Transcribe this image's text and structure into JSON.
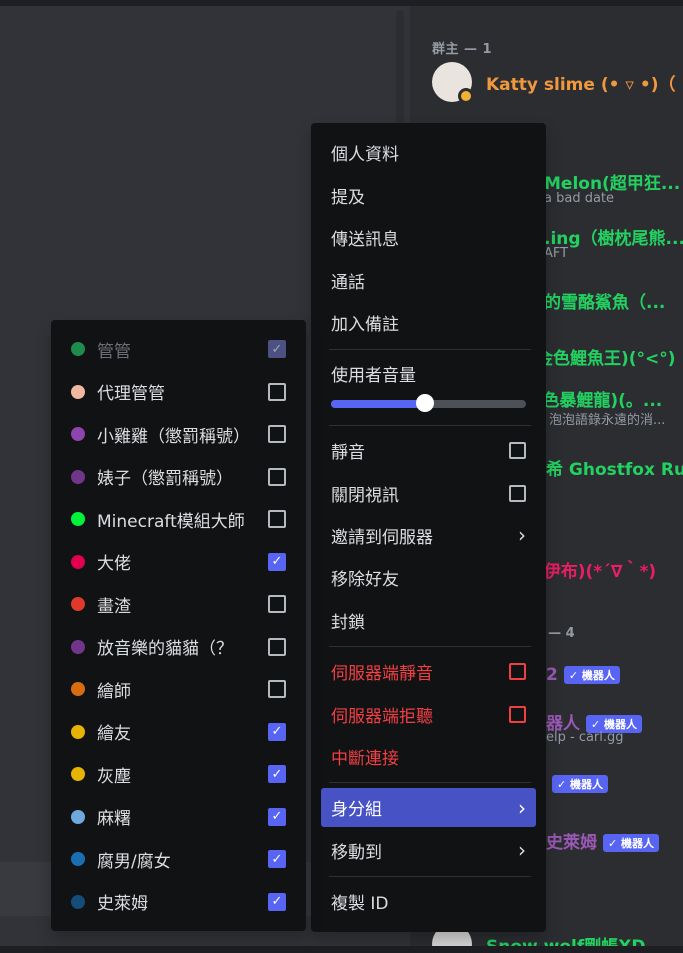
{
  "member_list": {
    "owner_header": "群主 — 1",
    "owner": {
      "name": "Katty slime (• ▿ •)（ ...",
      "color": "#f0983e"
    },
    "partials": [
      {
        "text": "Melon(超甲狂...",
        "color": "#23d160"
      },
      {
        "text": "a bad date",
        "color": "#949ba4"
      },
      {
        "text": ".ing（樹枕尾熊...",
        "color": "#23d160"
      },
      {
        "text": "AFT",
        "color": "#949ba4"
      },
      {
        "text": "的雪酪鯊魚（...",
        "color": "#23d160"
      },
      {
        "text": "金色鯉魚王)(°<°)",
        "color": "#23d160"
      },
      {
        "text": "I色暴鯉龍)(。...",
        "color": "#23d160"
      },
      {
        "text": "、泡泡語錄永遠的消...",
        "color": "#949ba4"
      },
      {
        "text": "希 Ghostfox Ru...",
        "color": "#23d160"
      },
      {
        "text": "(伊布)(*´∇｀*)",
        "color": "#e91e63"
      },
      {
        "text": "? — 4",
        "color": "#949ba4"
      },
      {
        "text": "2",
        "color": "#9b59b6"
      },
      {
        "text": "器人",
        "color": "#9b59b6"
      },
      {
        "text": "elp - carl.gg",
        "color": "#949ba4"
      },
      {
        "text": "史萊姆",
        "color": "#9b59b6"
      },
      {
        "text": "Snow wolf剛帳XD",
        "color": "#23d160"
      }
    ],
    "bot_tag": "✓ 機器人"
  },
  "context_menu": {
    "items": [
      {
        "label": "個人資料"
      },
      {
        "label": "提及"
      },
      {
        "label": "傳送訊息"
      },
      {
        "label": "通話"
      },
      {
        "label": "加入備註"
      }
    ],
    "volume_label": "使用者音量",
    "volume": 0.48,
    "toggles": [
      {
        "label": "靜音"
      },
      {
        "label": "關閉視訊"
      }
    ],
    "invite_label": "邀請到伺服器",
    "remove_friend_label": "移除好友",
    "block_label": "封鎖",
    "server_mute_label": "伺服器端靜音",
    "server_deafen_label": "伺服器端拒聽",
    "disconnect_label": "中斷連接",
    "roles_label": "身分組",
    "move_label": "移動到",
    "copy_id_label": "複製 ID"
  },
  "roles": [
    {
      "name": "管管",
      "color": "#1f8b4c",
      "checked": true,
      "disabled": true
    },
    {
      "name": "代理管管",
      "color": "#f0b8a0",
      "checked": false
    },
    {
      "name": "小雞雞（懲罰稱號）",
      "color": "#8e44ad",
      "checked": false
    },
    {
      "name": "婊子（懲罰稱號）",
      "color": "#71368a",
      "checked": false
    },
    {
      "name": "Minecraft模組大師",
      "color": "#00f23c",
      "checked": false
    },
    {
      "name": "大佬",
      "color": "#e0004d",
      "checked": true
    },
    {
      "name": "畫渣",
      "color": "#e0392b",
      "checked": false
    },
    {
      "name": "放音樂的貓貓（？",
      "color": "#71368a",
      "checked": false
    },
    {
      "name": "繪師",
      "color": "#d96b10",
      "checked": false
    },
    {
      "name": "繪友",
      "color": "#e6b300",
      "checked": true
    },
    {
      "name": "灰塵",
      "color": "#e6b300",
      "checked": true
    },
    {
      "name": "麻糬",
      "color": "#6fa8dc",
      "checked": true
    },
    {
      "name": "腐男/腐女",
      "color": "#1a6fb3",
      "checked": true
    },
    {
      "name": "史萊姆",
      "color": "#154c79",
      "checked": true
    }
  ]
}
